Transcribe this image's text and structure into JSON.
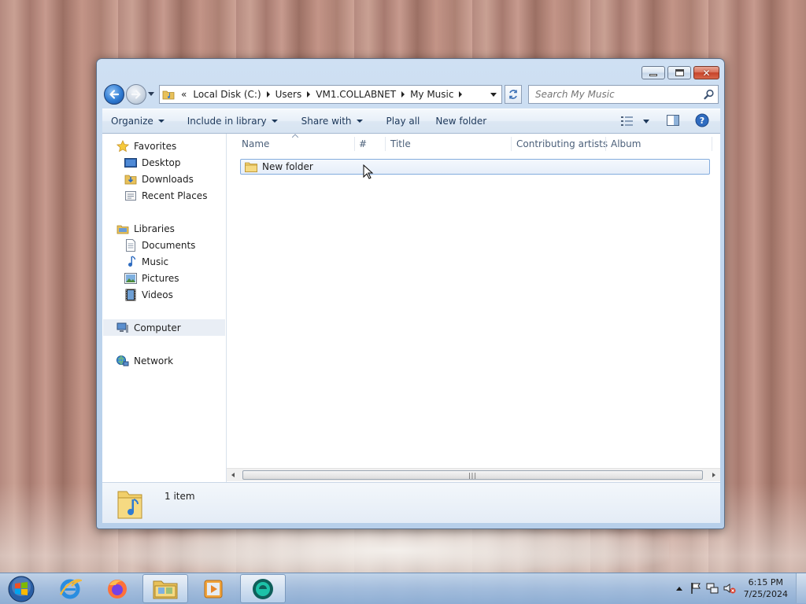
{
  "window": {
    "controls": {
      "minimize": "minimize",
      "maximize": "maximize",
      "close": "close"
    }
  },
  "address_bar": {
    "overflow": "«",
    "crumbs": [
      "Local Disk (C:)",
      "Users",
      "VM1.COLLABNET",
      "My Music"
    ]
  },
  "search": {
    "placeholder": "Search My Music"
  },
  "commands": {
    "organize": "Organize",
    "include_in_library": "Include in library",
    "share_with": "Share with",
    "play_all": "Play all",
    "new_folder": "New folder"
  },
  "nav": {
    "favorites": "Favorites",
    "desktop": "Desktop",
    "downloads": "Downloads",
    "recent_places": "Recent Places",
    "libraries": "Libraries",
    "documents": "Documents",
    "music": "Music",
    "pictures": "Pictures",
    "videos": "Videos",
    "computer": "Computer",
    "network": "Network"
  },
  "columns": {
    "name": "Name",
    "number": "#",
    "title": "Title",
    "contributing_artists": "Contributing artists",
    "album": "Album"
  },
  "files": [
    {
      "name": "New folder",
      "type": "folder"
    }
  ],
  "details": {
    "count": "1 item"
  },
  "taskbar": {
    "time": "6:15 PM",
    "date": "7/25/2024",
    "apps": [
      "start-orb",
      "internet-explorer",
      "firefox",
      "windows-explorer",
      "media-player",
      "app-circle"
    ]
  },
  "colors": {
    "accent": "#1e395b",
    "selection_border": "#84acdd",
    "window_frame": "#bcd3ec"
  }
}
